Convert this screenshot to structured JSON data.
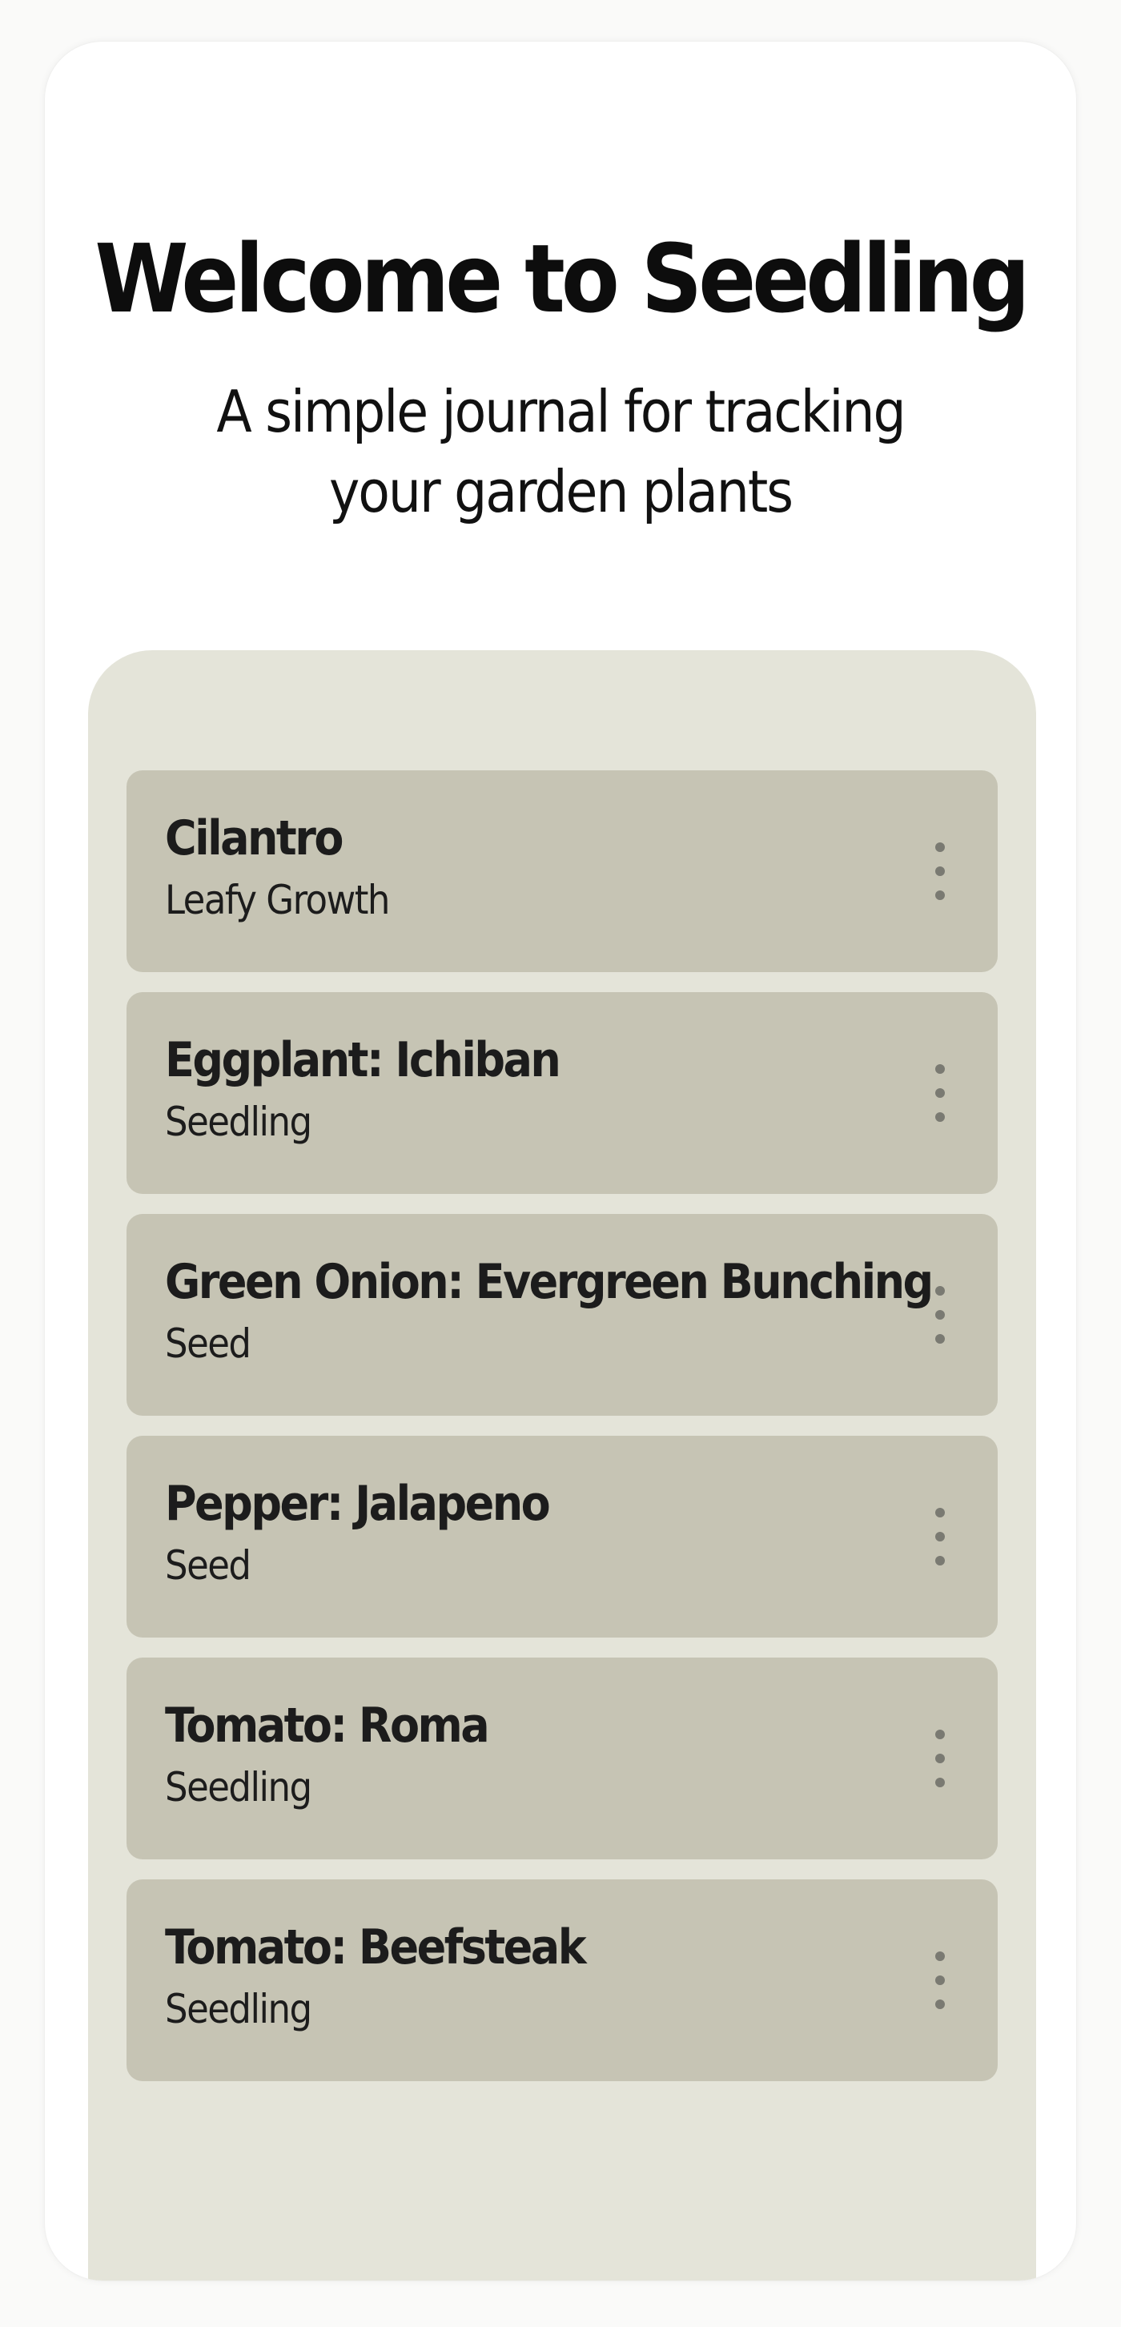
{
  "header": {
    "title": "Welcome to Seedling",
    "subtitle": "A simple journal for tracking your garden plants"
  },
  "plants": [
    {
      "name": "Cilantro",
      "stage": "Leafy Growth"
    },
    {
      "name": "Eggplant: Ichiban",
      "stage": "Seedling"
    },
    {
      "name": "Green Onion: Evergreen Bunching",
      "stage": "Seed"
    },
    {
      "name": "Pepper: Jalapeno",
      "stage": "Seed"
    },
    {
      "name": "Tomato: Roma",
      "stage": "Seedling"
    },
    {
      "name": "Tomato: Beefsteak",
      "stage": "Seedling"
    }
  ],
  "icons": {
    "card_menu": "more-vertical-icon"
  },
  "colors": {
    "background": "#ffffff",
    "panel": "#e4e4d9",
    "card": "#c6c4b4",
    "text": "#111111",
    "menu_dots": "#7a7a72"
  }
}
